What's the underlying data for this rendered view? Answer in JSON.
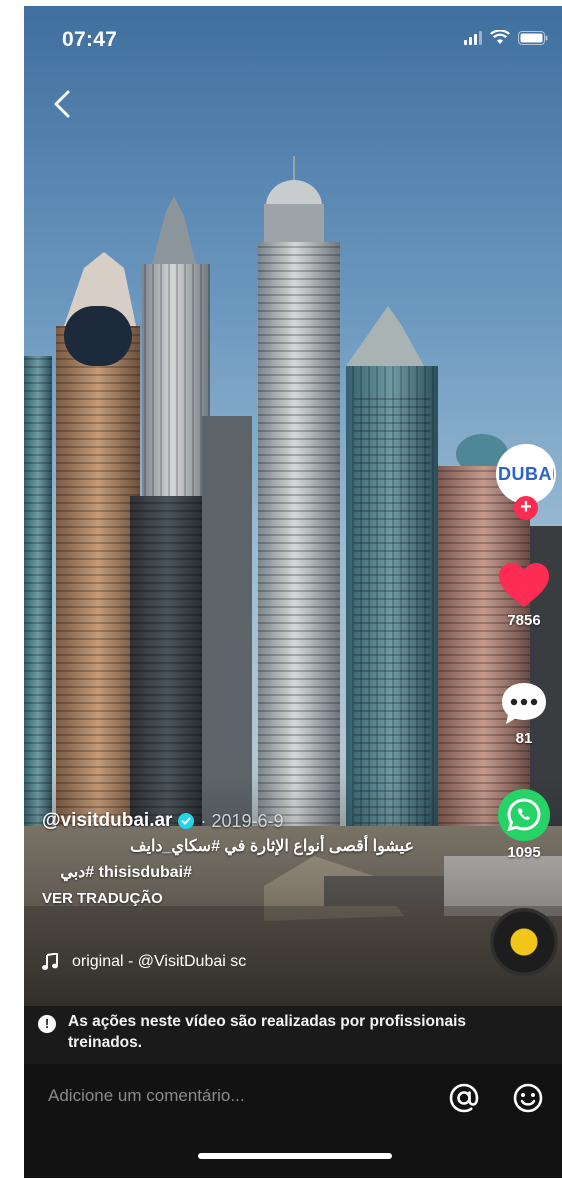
{
  "status_bar": {
    "time": "07:47"
  },
  "icons": {
    "back": "chevron-left-icon",
    "like": "heart-icon",
    "comment": "speech-bubble-icon",
    "share": "whatsapp-icon",
    "music": "music-note-icon",
    "mention": "at-sign-icon",
    "emoji": "smiley-icon",
    "warning": "exclamation-icon"
  },
  "colors": {
    "like": "#fe2c55",
    "whatsapp": "#25d366",
    "follow": "#fe2c55",
    "disc_center": "#f2c61b"
  },
  "profile": {
    "avatar_text": "DUBAI",
    "follow_symbol": "+"
  },
  "actions": {
    "likes": "7856",
    "comments": "81",
    "shares": "1095"
  },
  "post": {
    "author": "@visitdubai.ar",
    "date": "· 2019-6-9",
    "caption_line1": "عيشوا أقصى أنواع الإثارة في #سكاي_دايف",
    "caption_line2": "#thisisdubai  #دبي",
    "translate_label": "VER TRADUÇÃO",
    "music_label": "original - @VisitDubai     sc"
  },
  "notice": {
    "text": "As ações neste vídeo são realizadas por profissionais treinados."
  },
  "comment_bar": {
    "placeholder": "Adicione um comentário..."
  }
}
